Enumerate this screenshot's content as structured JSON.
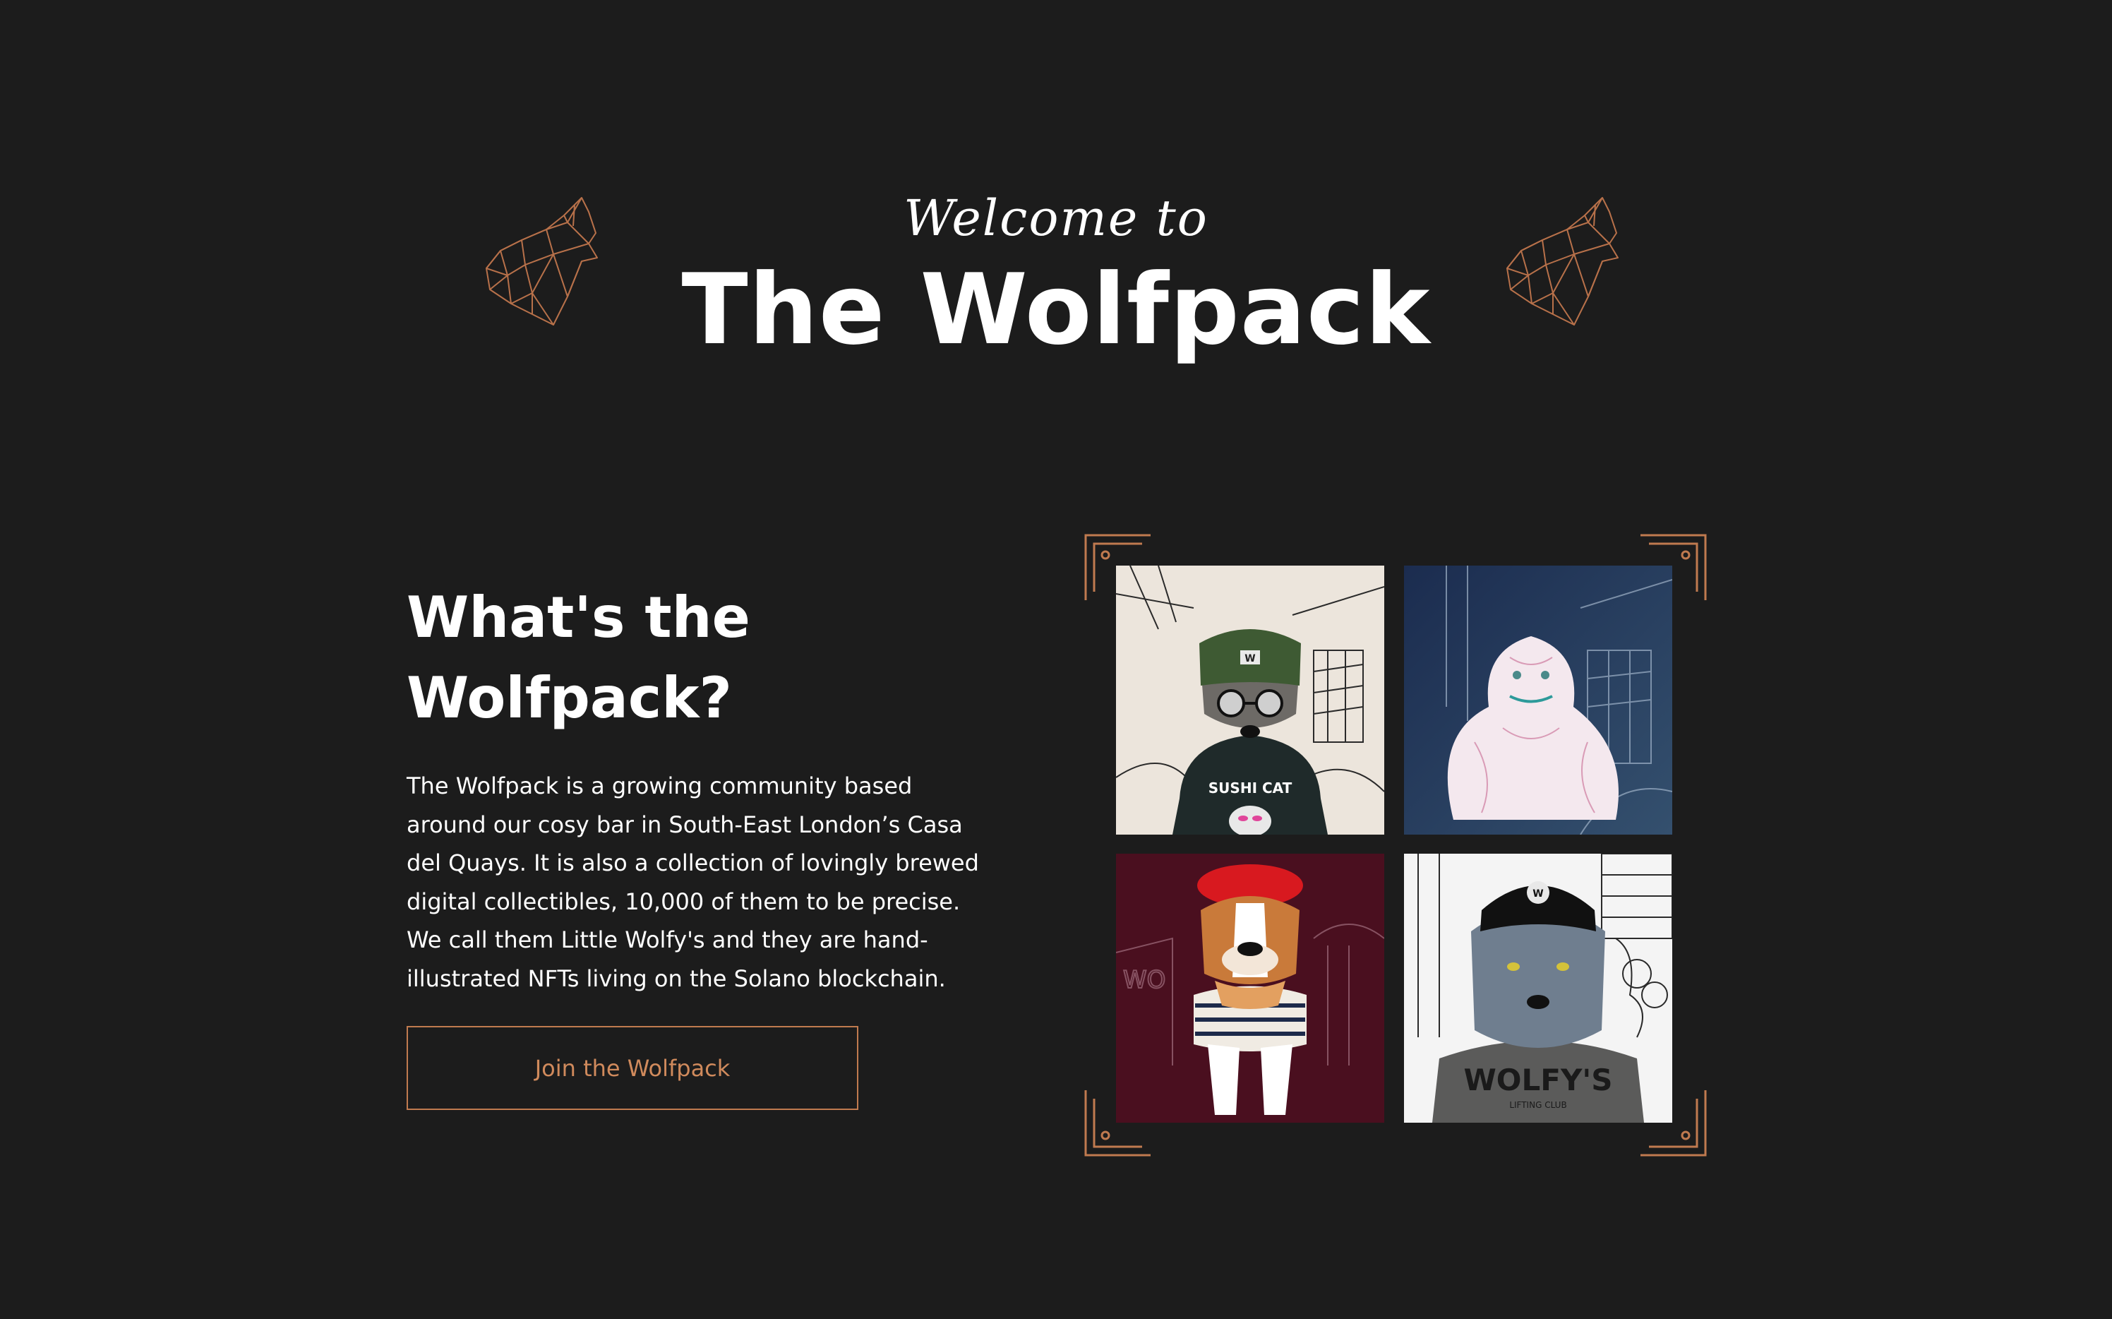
{
  "hero": {
    "welcome": "Welcome to",
    "title": "The Wolfpack"
  },
  "about": {
    "heading_line1": "What's the",
    "heading_line2": "Wolfpack?",
    "body_lines": [
      "The Wolfpack is a growing community based",
      "around our cosy bar in South-East London’s Casa",
      "del Quays. It is also a collection of lovingly brewed",
      "digital collectibles, 10,000 of them to be precise.",
      "We call them Little Wolfy's and they are hand-",
      "illustrated NFTs living on the Solano blockchain."
    ],
    "cta_label": "Join the Wolfpack"
  },
  "gallery": {
    "items": [
      {
        "name": "wolf-in-beanie-sushi-cat-hoodie",
        "print": "SUSHI CAT",
        "cap_badge": "W"
      },
      {
        "name": "white-persian-cat"
      },
      {
        "name": "bulldog-in-beret-striped-sweater"
      },
      {
        "name": "wolf-in-cap-wolfys-sweatshirt",
        "print": "WOLFY'S",
        "subprint": "LIFTING CLUB",
        "cap_badge": "W"
      }
    ]
  },
  "colors": {
    "background": "#1c1c1c",
    "accent": "#c07a4f",
    "text": "#ffffff"
  },
  "icons": [
    "howling-wolf-geometric-icon",
    "frame-corner-ornament-icon"
  ]
}
